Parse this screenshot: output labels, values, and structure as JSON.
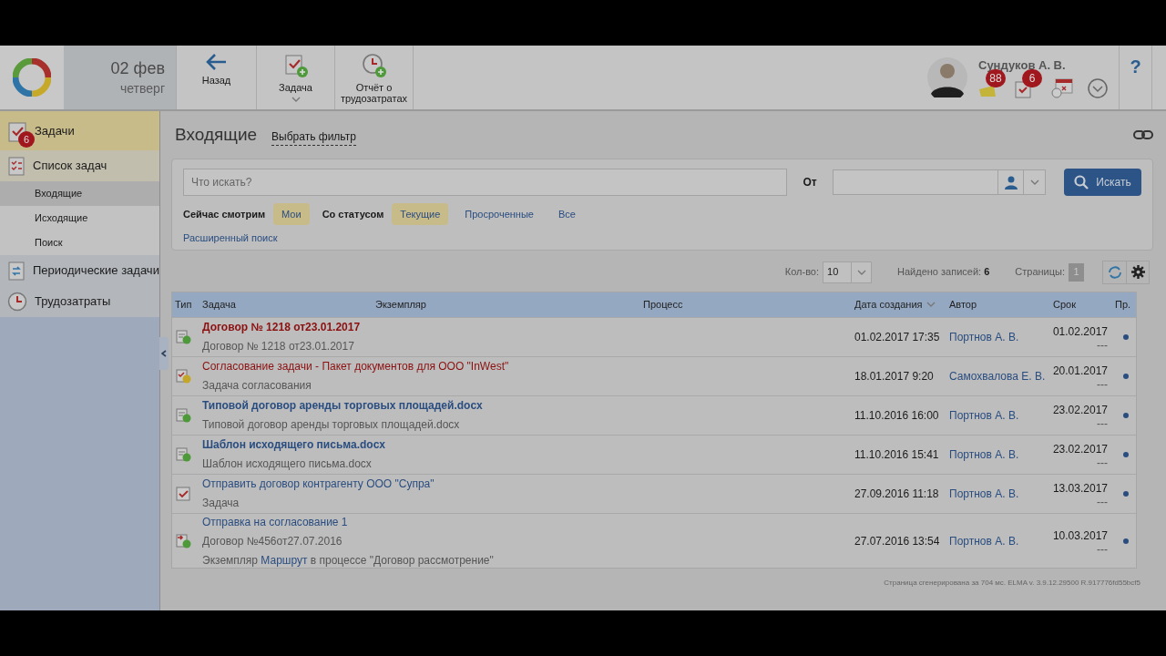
{
  "header": {
    "date": {
      "day": "02 фев",
      "weekday": "четверг"
    },
    "toolbar": [
      {
        "kind": "back",
        "label": "Назад"
      },
      {
        "kind": "task",
        "label": "Задача",
        "dropdown": true
      },
      {
        "kind": "report",
        "label": "Отчёт о трудозатратах"
      }
    ],
    "user": {
      "name": "Сундуков А. В.",
      "badges": [
        {
          "kind": "mail",
          "count": "88"
        },
        {
          "kind": "tasks",
          "count": "6"
        },
        {
          "kind": "calendar"
        }
      ]
    },
    "help": "?"
  },
  "sidebar": {
    "items": [
      {
        "kind": "tasks",
        "label": "Задачи",
        "badge": "6",
        "selected": true
      },
      {
        "kind": "list",
        "label": "Список задач",
        "selected": false,
        "expanded": true,
        "children": [
          {
            "label": "Входящие",
            "selected": true
          },
          {
            "label": "Исходящие",
            "selected": false
          },
          {
            "label": "Поиск",
            "selected": false
          }
        ]
      },
      {
        "kind": "periodic",
        "label": "Периодические задачи",
        "selected": false
      },
      {
        "kind": "time",
        "label": "Трудозатраты",
        "selected": false
      }
    ]
  },
  "main": {
    "title": "Входящие",
    "filter_link": "Выбрать фильтр",
    "search": {
      "placeholder": "Что искать?",
      "from_label": "От",
      "button": "Искать"
    },
    "filters": [
      {
        "label": "Сейчас смотрим",
        "options": [
          {
            "label": "Мои",
            "selected": true
          }
        ]
      },
      {
        "label": "Со статусом",
        "options": [
          {
            "label": "Текущие",
            "selected": true
          },
          {
            "label": "Просроченные",
            "selected": false
          },
          {
            "label": "Все",
            "selected": false
          }
        ]
      }
    ],
    "advanced_search": "Расширенный поиск",
    "pager": {
      "count_label": "Кол-во:",
      "count": "10",
      "found_label": "Найдено записей:",
      "found": "6",
      "pages_label": "Страницы:",
      "page": "1"
    },
    "table": {
      "columns": [
        {
          "label": "Тип"
        },
        {
          "label": "Задача"
        },
        {
          "label": "Экземпляр"
        },
        {
          "label": "Процесс"
        },
        {
          "label": "Дата создания",
          "sorted": true
        },
        {
          "label": "Автор"
        },
        {
          "label": "Срок"
        },
        {
          "label": "Пр."
        }
      ],
      "rows": [
        {
          "kind": "document",
          "title": "Договор № 1218 от23.01.2017",
          "overdue": true,
          "unread": true,
          "subtitle": "Договор № 1218 от23.01.2017",
          "created": "01.02.2017 17:35",
          "author": "Портнов А. В.",
          "due": "01.02.2017",
          "due_note": "---"
        },
        {
          "kind": "approval",
          "title": "Согласование задачи - Пакет документов для ООО \"InWest\"",
          "overdue": true,
          "unread": false,
          "subtitle": "Задача согласования",
          "created": "18.01.2017 9:20",
          "author": "Самохвалова Е. В.",
          "due": "20.01.2017",
          "due_note": "---"
        },
        {
          "kind": "document",
          "title": "Типовой договор аренды торговых площадей.docx",
          "overdue": false,
          "unread": true,
          "subtitle": "Типовой договор аренды торговых площадей.docx",
          "created": "11.10.2016 16:00",
          "author": "Портнов А. В.",
          "due": "23.02.2017",
          "due_note": "---"
        },
        {
          "kind": "document",
          "title": "Шаблон исходящего письма.docx",
          "overdue": false,
          "unread": true,
          "subtitle": "Шаблон исходящего письма.docx",
          "created": "11.10.2016 15:41",
          "author": "Портнов А. В.",
          "due": "23.02.2017",
          "due_note": "---"
        },
        {
          "kind": "task",
          "title": "Отправить договор контрагенту ООО \"Супра\"",
          "overdue": false,
          "unread": false,
          "subtitle": "Задача",
          "created": "27.09.2016 11:18",
          "author": "Портнов А. В.",
          "due": "13.03.2017",
          "due_note": "---"
        },
        {
          "kind": "route",
          "title": "Отправка на согласование 1",
          "overdue": false,
          "unread": false,
          "subtitle": "Договор №456от27.07.2016",
          "note": {
            "before": "Экземпляр",
            "link": "Маршрут",
            "after": "в процессе \"Договор рассмотрение\""
          },
          "created": "27.07.2016 13:54",
          "author": "Портнов А. В.",
          "due": "10.03.2017",
          "due_note": "---"
        }
      ]
    },
    "footer": "Страница сгенерирована за 704 мс. ELMA v. 3.9.12.29500 R.917776fd55bcf5"
  }
}
